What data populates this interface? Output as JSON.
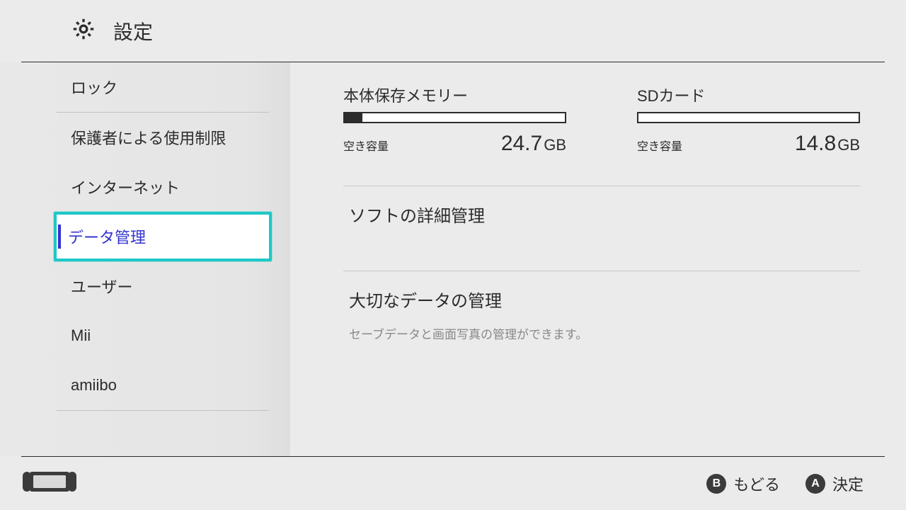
{
  "header": {
    "title": "設定"
  },
  "sidebar": {
    "items": [
      {
        "label": "ロック"
      },
      {
        "label": "保護者による使用制限"
      },
      {
        "label": "インターネット"
      },
      {
        "label": "データ管理",
        "selected": true
      },
      {
        "label": "ユーザー"
      },
      {
        "label": "Mii"
      },
      {
        "label": "amiibo"
      }
    ]
  },
  "main": {
    "storage": [
      {
        "title": "本体保存メモリー",
        "free_label": "空き容量",
        "free_value": "24.7",
        "free_unit": "GB",
        "fill_percent": 8
      },
      {
        "title": "SDカード",
        "free_label": "空き容量",
        "free_value": "14.8",
        "free_unit": "GB",
        "fill_percent": 0
      }
    ],
    "section1": {
      "title": "ソフトの詳細管理"
    },
    "section2": {
      "title": "大切なデータの管理",
      "desc": "セーブデータと画面写真の管理ができます。"
    }
  },
  "footer": {
    "back": {
      "glyph": "B",
      "label": "もどる"
    },
    "ok": {
      "glyph": "A",
      "label": "決定"
    }
  }
}
